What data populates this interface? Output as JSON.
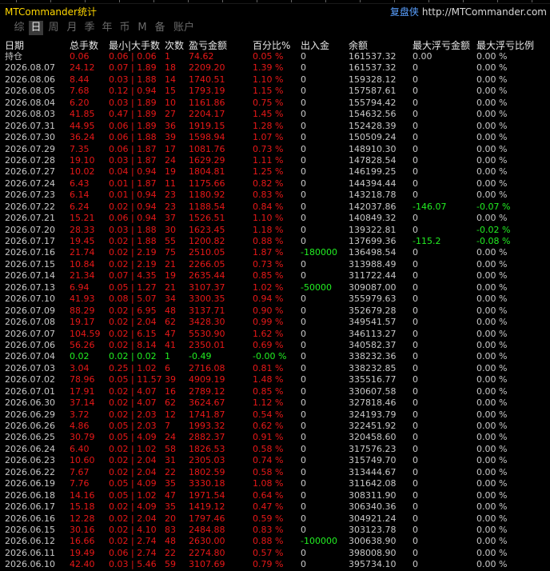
{
  "app": {
    "title": "MTCommander统计",
    "brand_cn": "复盘侠",
    "brand_url": "http://MTCommander.com",
    "accent_color": "#ffd700",
    "loss_color": "#e81818",
    "gain_color": "#22ee22"
  },
  "tabs": [
    {
      "label": "综",
      "active": false
    },
    {
      "label": "日",
      "active": true
    },
    {
      "label": "周",
      "active": false
    },
    {
      "label": "月",
      "active": false
    },
    {
      "label": "季",
      "active": false
    },
    {
      "label": "年",
      "active": false
    },
    {
      "label": "币",
      "active": false
    },
    {
      "label": "M",
      "active": false
    },
    {
      "label": "备",
      "active": false
    },
    {
      "label": "账户",
      "active": false
    }
  ],
  "columns": [
    "日期",
    "总手数",
    "最小|大手数",
    "次数",
    "盈亏金额",
    "百分比%",
    "出入金",
    "余额",
    "最大浮亏金额",
    "最大浮亏比例"
  ],
  "rows": [
    {
      "date": "持仓",
      "lots": "0.06",
      "minmax": "0.06 | 0.06",
      "count": "1",
      "pnl": "74.62",
      "pct": "0.05 %",
      "io": "0",
      "bal": "161537.32",
      "fl": "0.00",
      "flp": "0.00 %",
      "c": "rd"
    },
    {
      "date": "2026.08.07",
      "lots": "24.12",
      "minmax": "0.07 | 1.89",
      "count": "18",
      "pnl": "2209.20",
      "pct": "1.39 %",
      "io": "0",
      "bal": "161537.32",
      "fl": "0",
      "flp": "0.00 %",
      "c": "rd"
    },
    {
      "date": "2026.08.06",
      "lots": "8.44",
      "minmax": "0.03 | 1.88",
      "count": "14",
      "pnl": "1740.51",
      "pct": "1.10 %",
      "io": "0",
      "bal": "159328.12",
      "fl": "0",
      "flp": "0.00 %",
      "c": "rd"
    },
    {
      "date": "2026.08.05",
      "lots": "7.68",
      "minmax": "0.12 | 0.94",
      "count": "15",
      "pnl": "1793.19",
      "pct": "1.15 %",
      "io": "0",
      "bal": "157587.61",
      "fl": "0",
      "flp": "0.00 %",
      "c": "rd"
    },
    {
      "date": "2026.08.04",
      "lots": "6.20",
      "minmax": "0.03 | 1.89",
      "count": "10",
      "pnl": "1161.86",
      "pct": "0.75 %",
      "io": "0",
      "bal": "155794.42",
      "fl": "0",
      "flp": "0.00 %",
      "c": "rd"
    },
    {
      "date": "2026.08.03",
      "lots": "41.85",
      "minmax": "0.47 | 1.89",
      "count": "27",
      "pnl": "2204.17",
      "pct": "1.45 %",
      "io": "0",
      "bal": "154632.56",
      "fl": "0",
      "flp": "0.00 %",
      "c": "rd"
    },
    {
      "date": "2026.07.31",
      "lots": "44.95",
      "minmax": "0.06 | 1.89",
      "count": "36",
      "pnl": "1919.15",
      "pct": "1.28 %",
      "io": "0",
      "bal": "152428.39",
      "fl": "0",
      "flp": "0.00 %",
      "c": "rd"
    },
    {
      "date": "2026.07.30",
      "lots": "36.24",
      "minmax": "0.06 | 1.88",
      "count": "39",
      "pnl": "1598.94",
      "pct": "1.07 %",
      "io": "0",
      "bal": "150509.24",
      "fl": "0",
      "flp": "0.00 %",
      "c": "rd"
    },
    {
      "date": "2026.07.29",
      "lots": "7.35",
      "minmax": "0.06 | 1.87",
      "count": "17",
      "pnl": "1081.76",
      "pct": "0.73 %",
      "io": "0",
      "bal": "148910.30",
      "fl": "0",
      "flp": "0.00 %",
      "c": "rd"
    },
    {
      "date": "2026.07.28",
      "lots": "19.10",
      "minmax": "0.03 | 1.87",
      "count": "24",
      "pnl": "1629.29",
      "pct": "1.11 %",
      "io": "0",
      "bal": "147828.54",
      "fl": "0",
      "flp": "0.00 %",
      "c": "rd"
    },
    {
      "date": "2026.07.27",
      "lots": "10.02",
      "minmax": "0.04 | 0.94",
      "count": "19",
      "pnl": "1804.81",
      "pct": "1.25 %",
      "io": "0",
      "bal": "146199.25",
      "fl": "0",
      "flp": "0.00 %",
      "c": "rd"
    },
    {
      "date": "2026.07.24",
      "lots": "6.43",
      "minmax": "0.01 | 1.87",
      "count": "11",
      "pnl": "1175.66",
      "pct": "0.82 %",
      "io": "0",
      "bal": "144394.44",
      "fl": "0",
      "flp": "0.00 %",
      "c": "rd"
    },
    {
      "date": "2026.07.23",
      "lots": "6.14",
      "minmax": "0.01 | 0.94",
      "count": "23",
      "pnl": "1180.92",
      "pct": "0.83 %",
      "io": "0",
      "bal": "143218.78",
      "fl": "0",
      "flp": "0.00 %",
      "c": "rd"
    },
    {
      "date": "2026.07.22",
      "lots": "6.24",
      "minmax": "0.02 | 0.94",
      "count": "23",
      "pnl": "1188.54",
      "pct": "0.84 %",
      "io": "0",
      "bal": "142037.86",
      "fl": "-146.07",
      "flp": "-0.07 %",
      "c": "rd",
      "fc": "gr"
    },
    {
      "date": "2026.07.21",
      "lots": "15.21",
      "minmax": "0.06 | 0.94",
      "count": "37",
      "pnl": "1526.51",
      "pct": "1.10 %",
      "io": "0",
      "bal": "140849.32",
      "fl": "0",
      "flp": "0.00 %",
      "c": "rd"
    },
    {
      "date": "2026.07.20",
      "lots": "28.33",
      "minmax": "0.03 | 1.88",
      "count": "30",
      "pnl": "1623.45",
      "pct": "1.18 %",
      "io": "0",
      "bal": "139322.81",
      "fl": "0",
      "flp": "-0.02 %",
      "c": "rd",
      "fpc": "gr"
    },
    {
      "date": "2026.07.17",
      "lots": "19.45",
      "minmax": "0.02 | 1.88",
      "count": "55",
      "pnl": "1200.82",
      "pct": "0.88 %",
      "io": "0",
      "bal": "137699.36",
      "fl": "-115.2",
      "flp": "-0.08 %",
      "c": "rd",
      "fc": "gr"
    },
    {
      "date": "2026.07.16",
      "lots": "21.74",
      "minmax": "0.02 | 2.19",
      "count": "75",
      "pnl": "2510.05",
      "pct": "1.87 %",
      "io": "-180000",
      "bal": "136498.54",
      "fl": "0",
      "flp": "0.00 %",
      "c": "rd",
      "ic": "gr"
    },
    {
      "date": "2026.07.15",
      "lots": "10.84",
      "minmax": "0.02 | 2.19",
      "count": "21",
      "pnl": "2266.05",
      "pct": "0.73 %",
      "io": "0",
      "bal": "313988.49",
      "fl": "0",
      "flp": "0.00 %",
      "c": "rd"
    },
    {
      "date": "2026.07.14",
      "lots": "21.34",
      "minmax": "0.07 | 4.35",
      "count": "19",
      "pnl": "2635.44",
      "pct": "0.85 %",
      "io": "0",
      "bal": "311722.44",
      "fl": "0",
      "flp": "0.00 %",
      "c": "rd"
    },
    {
      "date": "2026.07.13",
      "lots": "6.94",
      "minmax": "0.05 | 1.27",
      "count": "21",
      "pnl": "3107.37",
      "pct": "1.02 %",
      "io": "-50000",
      "bal": "309087.00",
      "fl": "0",
      "flp": "0.00 %",
      "c": "rd",
      "ic": "gr"
    },
    {
      "date": "2026.07.10",
      "lots": "41.93",
      "minmax": "0.08 | 5.07",
      "count": "34",
      "pnl": "3300.35",
      "pct": "0.94 %",
      "io": "0",
      "bal": "355979.63",
      "fl": "0",
      "flp": "0.00 %",
      "c": "rd"
    },
    {
      "date": "2026.07.09",
      "lots": "88.29",
      "minmax": "0.02 | 6.95",
      "count": "48",
      "pnl": "3137.71",
      "pct": "0.90 %",
      "io": "0",
      "bal": "352679.28",
      "fl": "0",
      "flp": "0.00 %",
      "c": "rd"
    },
    {
      "date": "2026.07.08",
      "lots": "19.17",
      "minmax": "0.02 | 2.04",
      "count": "62",
      "pnl": "3428.30",
      "pct": "0.99 %",
      "io": "0",
      "bal": "349541.57",
      "fl": "0",
      "flp": "0.00 %",
      "c": "rd"
    },
    {
      "date": "2026.07.07",
      "lots": "104.59",
      "minmax": "0.02 | 6.15",
      "count": "47",
      "pnl": "5530.90",
      "pct": "1.62 %",
      "io": "0",
      "bal": "346113.27",
      "fl": "0",
      "flp": "0.00 %",
      "c": "rd"
    },
    {
      "date": "2026.07.06",
      "lots": "56.26",
      "minmax": "0.02 | 8.14",
      "count": "41",
      "pnl": "2350.01",
      "pct": "0.69 %",
      "io": "0",
      "bal": "340582.37",
      "fl": "0",
      "flp": "0.00 %",
      "c": "rd"
    },
    {
      "date": "2026.07.04",
      "lots": "0.02",
      "minmax": "0.02 | 0.02",
      "count": "1",
      "pnl": "-0.49",
      "pct": "-0.00 %",
      "io": "0",
      "bal": "338232.36",
      "fl": "0",
      "flp": "0.00 %",
      "c": "gr"
    },
    {
      "date": "2026.07.03",
      "lots": "3.04",
      "minmax": "0.25 | 1.02",
      "count": "6",
      "pnl": "2716.08",
      "pct": "0.81 %",
      "io": "0",
      "bal": "338232.85",
      "fl": "0",
      "flp": "0.00 %",
      "c": "rd"
    },
    {
      "date": "2026.07.02",
      "lots": "78.96",
      "minmax": "0.05 | 11.57",
      "count": "39",
      "pnl": "4909.19",
      "pct": "1.48 %",
      "io": "0",
      "bal": "335516.77",
      "fl": "0",
      "flp": "0.00 %",
      "c": "rd"
    },
    {
      "date": "2026.07.01",
      "lots": "17.91",
      "minmax": "0.02 | 4.07",
      "count": "16",
      "pnl": "2789.12",
      "pct": "0.85 %",
      "io": "0",
      "bal": "330607.58",
      "fl": "0",
      "flp": "0.00 %",
      "c": "rd"
    },
    {
      "date": "2026.06.30",
      "lots": "37.14",
      "minmax": "0.02 | 4.07",
      "count": "62",
      "pnl": "3624.67",
      "pct": "1.12 %",
      "io": "0",
      "bal": "327818.46",
      "fl": "0",
      "flp": "0.00 %",
      "c": "rd"
    },
    {
      "date": "2026.06.29",
      "lots": "3.72",
      "minmax": "0.02 | 2.03",
      "count": "12",
      "pnl": "1741.87",
      "pct": "0.54 %",
      "io": "0",
      "bal": "324193.79",
      "fl": "0",
      "flp": "0.00 %",
      "c": "rd"
    },
    {
      "date": "2026.06.26",
      "lots": "4.86",
      "minmax": "0.05 | 2.03",
      "count": "7",
      "pnl": "1993.32",
      "pct": "0.62 %",
      "io": "0",
      "bal": "322451.92",
      "fl": "0",
      "flp": "0.00 %",
      "c": "rd"
    },
    {
      "date": "2026.06.25",
      "lots": "30.79",
      "minmax": "0.05 | 4.09",
      "count": "24",
      "pnl": "2882.37",
      "pct": "0.91 %",
      "io": "0",
      "bal": "320458.60",
      "fl": "0",
      "flp": "0.00 %",
      "c": "rd"
    },
    {
      "date": "2026.06.24",
      "lots": "6.40",
      "minmax": "0.02 | 1.02",
      "count": "58",
      "pnl": "1826.53",
      "pct": "0.58 %",
      "io": "0",
      "bal": "317576.23",
      "fl": "0",
      "flp": "0.00 %",
      "c": "rd"
    },
    {
      "date": "2026.06.23",
      "lots": "10.60",
      "minmax": "0.02 | 2.04",
      "count": "31",
      "pnl": "2305.03",
      "pct": "0.74 %",
      "io": "0",
      "bal": "315749.70",
      "fl": "0",
      "flp": "0.00 %",
      "c": "rd"
    },
    {
      "date": "2026.06.22",
      "lots": "7.67",
      "minmax": "0.02 | 2.04",
      "count": "22",
      "pnl": "1802.59",
      "pct": "0.58 %",
      "io": "0",
      "bal": "313444.67",
      "fl": "0",
      "flp": "0.00 %",
      "c": "rd"
    },
    {
      "date": "2026.06.19",
      "lots": "7.76",
      "minmax": "0.05 | 4.09",
      "count": "35",
      "pnl": "3330.18",
      "pct": "1.08 %",
      "io": "0",
      "bal": "311642.08",
      "fl": "0",
      "flp": "0.00 %",
      "c": "rd"
    },
    {
      "date": "2026.06.18",
      "lots": "14.16",
      "minmax": "0.05 | 1.02",
      "count": "47",
      "pnl": "1971.54",
      "pct": "0.64 %",
      "io": "0",
      "bal": "308311.90",
      "fl": "0",
      "flp": "0.00 %",
      "c": "rd"
    },
    {
      "date": "2026.06.17",
      "lots": "15.18",
      "minmax": "0.02 | 4.09",
      "count": "35",
      "pnl": "1419.12",
      "pct": "0.47 %",
      "io": "0",
      "bal": "306340.36",
      "fl": "0",
      "flp": "0.00 %",
      "c": "rd"
    },
    {
      "date": "2026.06.16",
      "lots": "12.28",
      "minmax": "0.02 | 2.04",
      "count": "20",
      "pnl": "1797.46",
      "pct": "0.59 %",
      "io": "0",
      "bal": "304921.24",
      "fl": "0",
      "flp": "0.00 %",
      "c": "rd"
    },
    {
      "date": "2026.06.15",
      "lots": "30.16",
      "minmax": "0.02 | 4.10",
      "count": "83",
      "pnl": "2484.88",
      "pct": "0.83 %",
      "io": "0",
      "bal": "303123.78",
      "fl": "0",
      "flp": "0.00 %",
      "c": "rd"
    },
    {
      "date": "2026.06.12",
      "lots": "16.66",
      "minmax": "0.02 | 2.74",
      "count": "48",
      "pnl": "2630.00",
      "pct": "0.88 %",
      "io": "-100000",
      "bal": "300638.90",
      "fl": "0",
      "flp": "0.00 %",
      "c": "rd",
      "ic": "gr"
    },
    {
      "date": "2026.06.11",
      "lots": "19.49",
      "minmax": "0.06 | 2.74",
      "count": "22",
      "pnl": "2274.80",
      "pct": "0.57 %",
      "io": "0",
      "bal": "398008.90",
      "fl": "0",
      "flp": "0.00 %",
      "c": "rd"
    },
    {
      "date": "2026.06.10",
      "lots": "42.40",
      "minmax": "0.03 | 5.46",
      "count": "59",
      "pnl": "3107.69",
      "pct": "0.79 %",
      "io": "0",
      "bal": "395734.10",
      "fl": "0",
      "flp": "0.00 %",
      "c": "rd"
    }
  ]
}
